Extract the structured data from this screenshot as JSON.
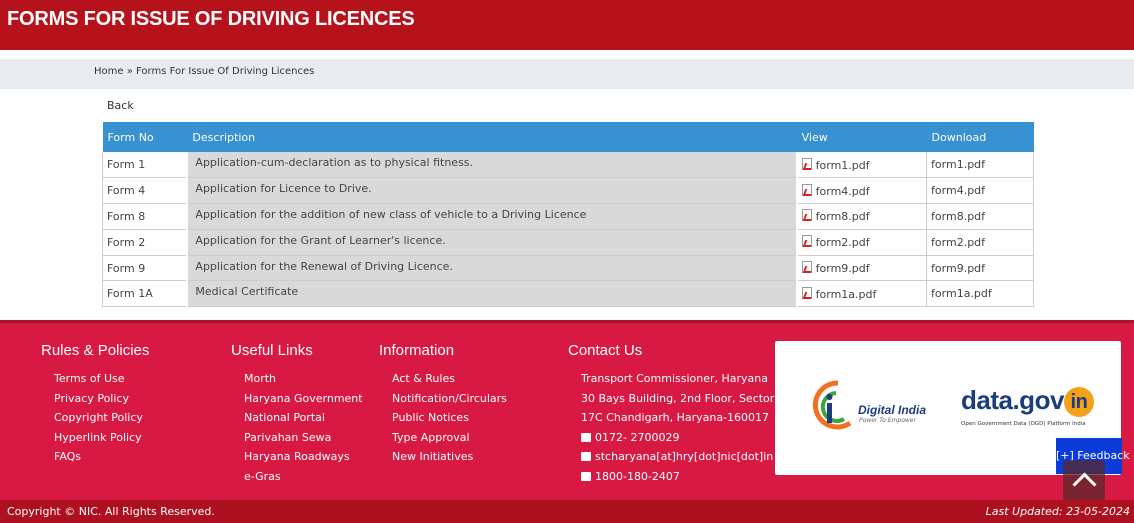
{
  "header": {
    "title": "FORMS FOR ISSUE OF DRIVING LICENCES"
  },
  "breadcrumb": {
    "home": "Home",
    "separator": " » ",
    "current": "Forms For Issue Of Driving Licences"
  },
  "back_label": "Back",
  "table": {
    "headers": {
      "form_no": "Form No",
      "description": "Description",
      "view": "View",
      "download": "Download"
    },
    "rows": [
      {
        "form_no": "Form 1",
        "description": "Application-cum-declaration as to physical fitness.",
        "view": "form1.pdf",
        "download": "form1.pdf"
      },
      {
        "form_no": "Form 4",
        "description": "Application for Licence to Drive.",
        "view": "form4.pdf",
        "download": "form4.pdf"
      },
      {
        "form_no": "Form 8",
        "description": "Application for the addition of new class of vehicle to a Driving Licence",
        "view": "form8.pdf",
        "download": "form8.pdf"
      },
      {
        "form_no": "Form 2",
        "description": "Application for the Grant of Learner's licence.",
        "view": "form2.pdf",
        "download": "form2.pdf"
      },
      {
        "form_no": "Form 9",
        "description": "Application for the Renewal of Driving Licence.",
        "view": "form9.pdf",
        "download": "form9.pdf"
      },
      {
        "form_no": "Form 1A",
        "description": "Medical Certificate",
        "view": "form1a.pdf",
        "download": "form1a.pdf"
      }
    ]
  },
  "footer": {
    "rules": {
      "title": "Rules & Policies",
      "items": [
        "Terms of Use",
        "Privacy Policy",
        "Copyright Policy",
        "Hyperlink Policy",
        "FAQs"
      ]
    },
    "links": {
      "title": "Useful Links",
      "items": [
        "Morth",
        "Haryana Government",
        "National Portal",
        "Parivahan Sewa",
        "Haryana Roadways",
        "e-Gras"
      ]
    },
    "info": {
      "title": "Information",
      "items": [
        "Act & Rules",
        "Notification/Circulars",
        "Public Notices",
        "Type Approval",
        "New Initiatives"
      ]
    },
    "contact": {
      "title": "Contact Us",
      "address1": "Transport Commissioner, Haryana",
      "address2": "30 Bays Building, 2nd Floor, Sector",
      "address3": "17C Chandigarh, Haryana-160017",
      "phone": "0172- 2700029",
      "email": "stcharyana[at]hry[dot]nic[dot]in",
      "tollfree": "1800-180-2407"
    },
    "logos": {
      "digital_india": "Digital India",
      "digital_india_tagline": "Power To Empower",
      "datagov_prefix": "data.gov",
      "datagov_in": "in",
      "datagov_tagline": "Open Government Data (OGD) Platform India"
    },
    "feedback_label": "[+] Feedback"
  },
  "bottom": {
    "copyright": "Copyright © NIC. All Rights Reserved.",
    "last_updated": "Last Updated: 23-05-2024"
  },
  "colors": {
    "header_red": "#b5121b",
    "footer_red": "#d81944",
    "table_header_blue": "#3891d0",
    "feedback_blue": "#0b3bd8"
  }
}
